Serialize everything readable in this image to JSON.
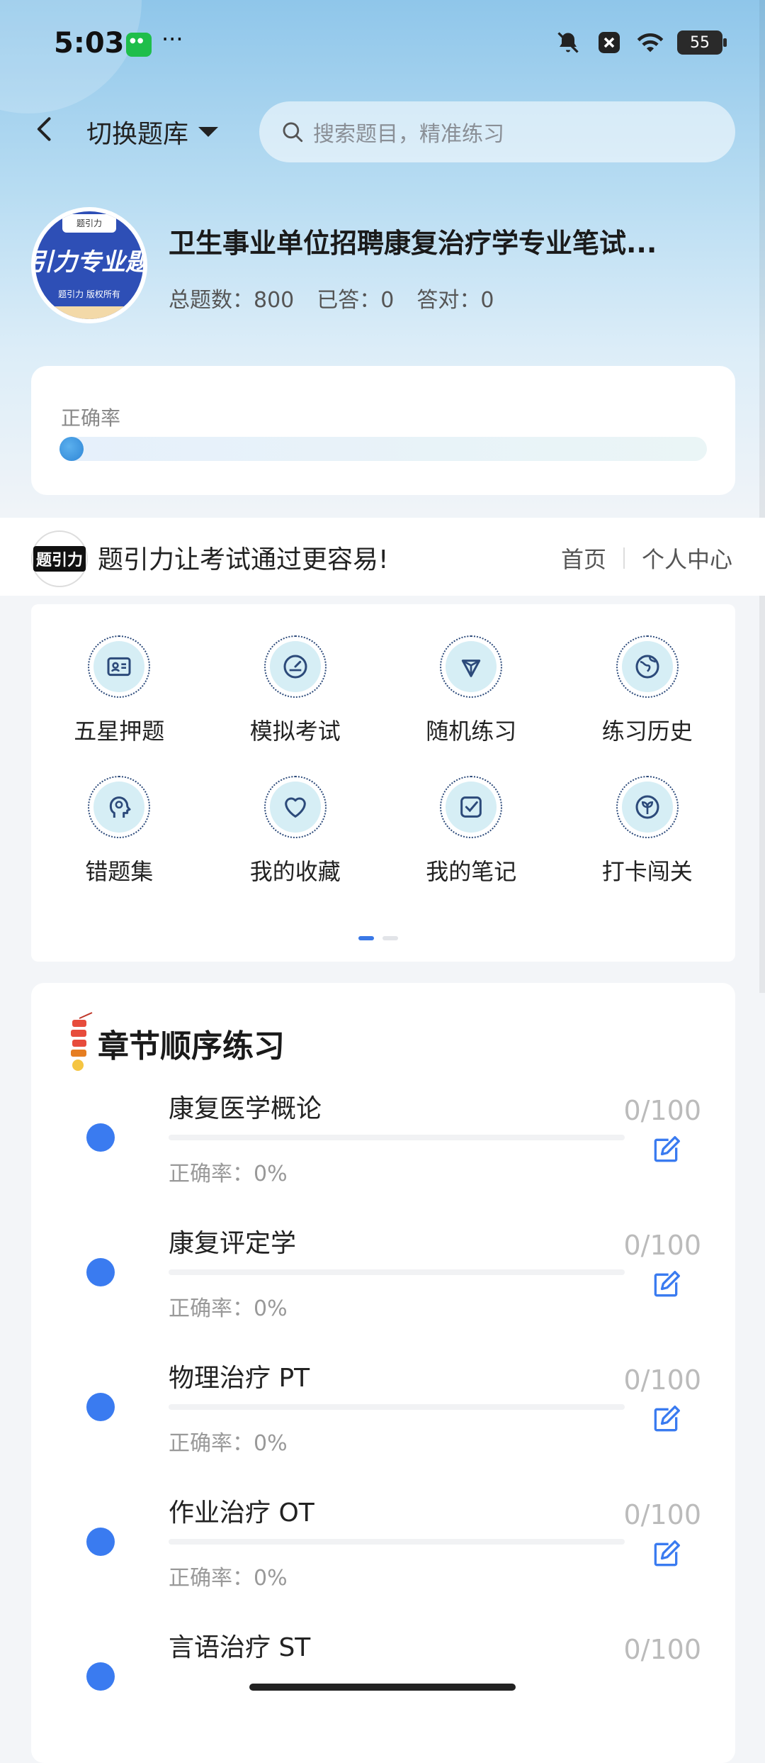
{
  "status_bar": {
    "time": "5:03",
    "more": "···",
    "battery": "55"
  },
  "header": {
    "switch_label": "切换题库",
    "search_placeholder": "搜索题目，精准练习"
  },
  "bank": {
    "logo_text": "引力专业题",
    "logo_sub": "题引力 版权所有",
    "logo_tag": "题引力",
    "title": "卫生事业单位招聘康复治疗学专业笔试...",
    "stats": {
      "total": "总题数：800",
      "answered": "已答：0",
      "correct": "答对：0"
    }
  },
  "accuracy": {
    "label": "正确率",
    "value": 0
  },
  "banner": {
    "logo": "题引力",
    "slogan": "题引力让考试通过更容易!",
    "nav_home": "首页",
    "nav_profile": "个人中心"
  },
  "features": [
    {
      "label": "五星押题",
      "icon": "id-card-icon"
    },
    {
      "label": "模拟考试",
      "icon": "speedometer-icon"
    },
    {
      "label": "随机练习",
      "icon": "network-icon"
    },
    {
      "label": "练习历史",
      "icon": "globe-icon"
    },
    {
      "label": "错题集",
      "icon": "head-icon"
    },
    {
      "label": "我的收藏",
      "icon": "heart-icon"
    },
    {
      "label": "我的笔记",
      "icon": "checklist-icon"
    },
    {
      "label": "打卡闯关",
      "icon": "sprout-icon"
    }
  ],
  "pager": {
    "pages": 2,
    "current": 0
  },
  "chapters": {
    "title": "章节顺序练习",
    "items": [
      {
        "name": "康复医学概论",
        "accuracy": "正确率：0%",
        "count": "0/100"
      },
      {
        "name": "康复评定学",
        "accuracy": "正确率：0%",
        "count": "0/100"
      },
      {
        "name": "物理治疗 PT",
        "accuracy": "正确率：0%",
        "count": "0/100"
      },
      {
        "name": "作业治疗 OT",
        "accuracy": "正确率：0%",
        "count": "0/100"
      },
      {
        "name": "言语治疗 ST",
        "accuracy": "",
        "count": "0/100"
      }
    ]
  },
  "colors": {
    "accent": "#3a7bf0",
    "icon_bg": "#d6eef5",
    "icon_stroke": "#2c4a7a"
  }
}
